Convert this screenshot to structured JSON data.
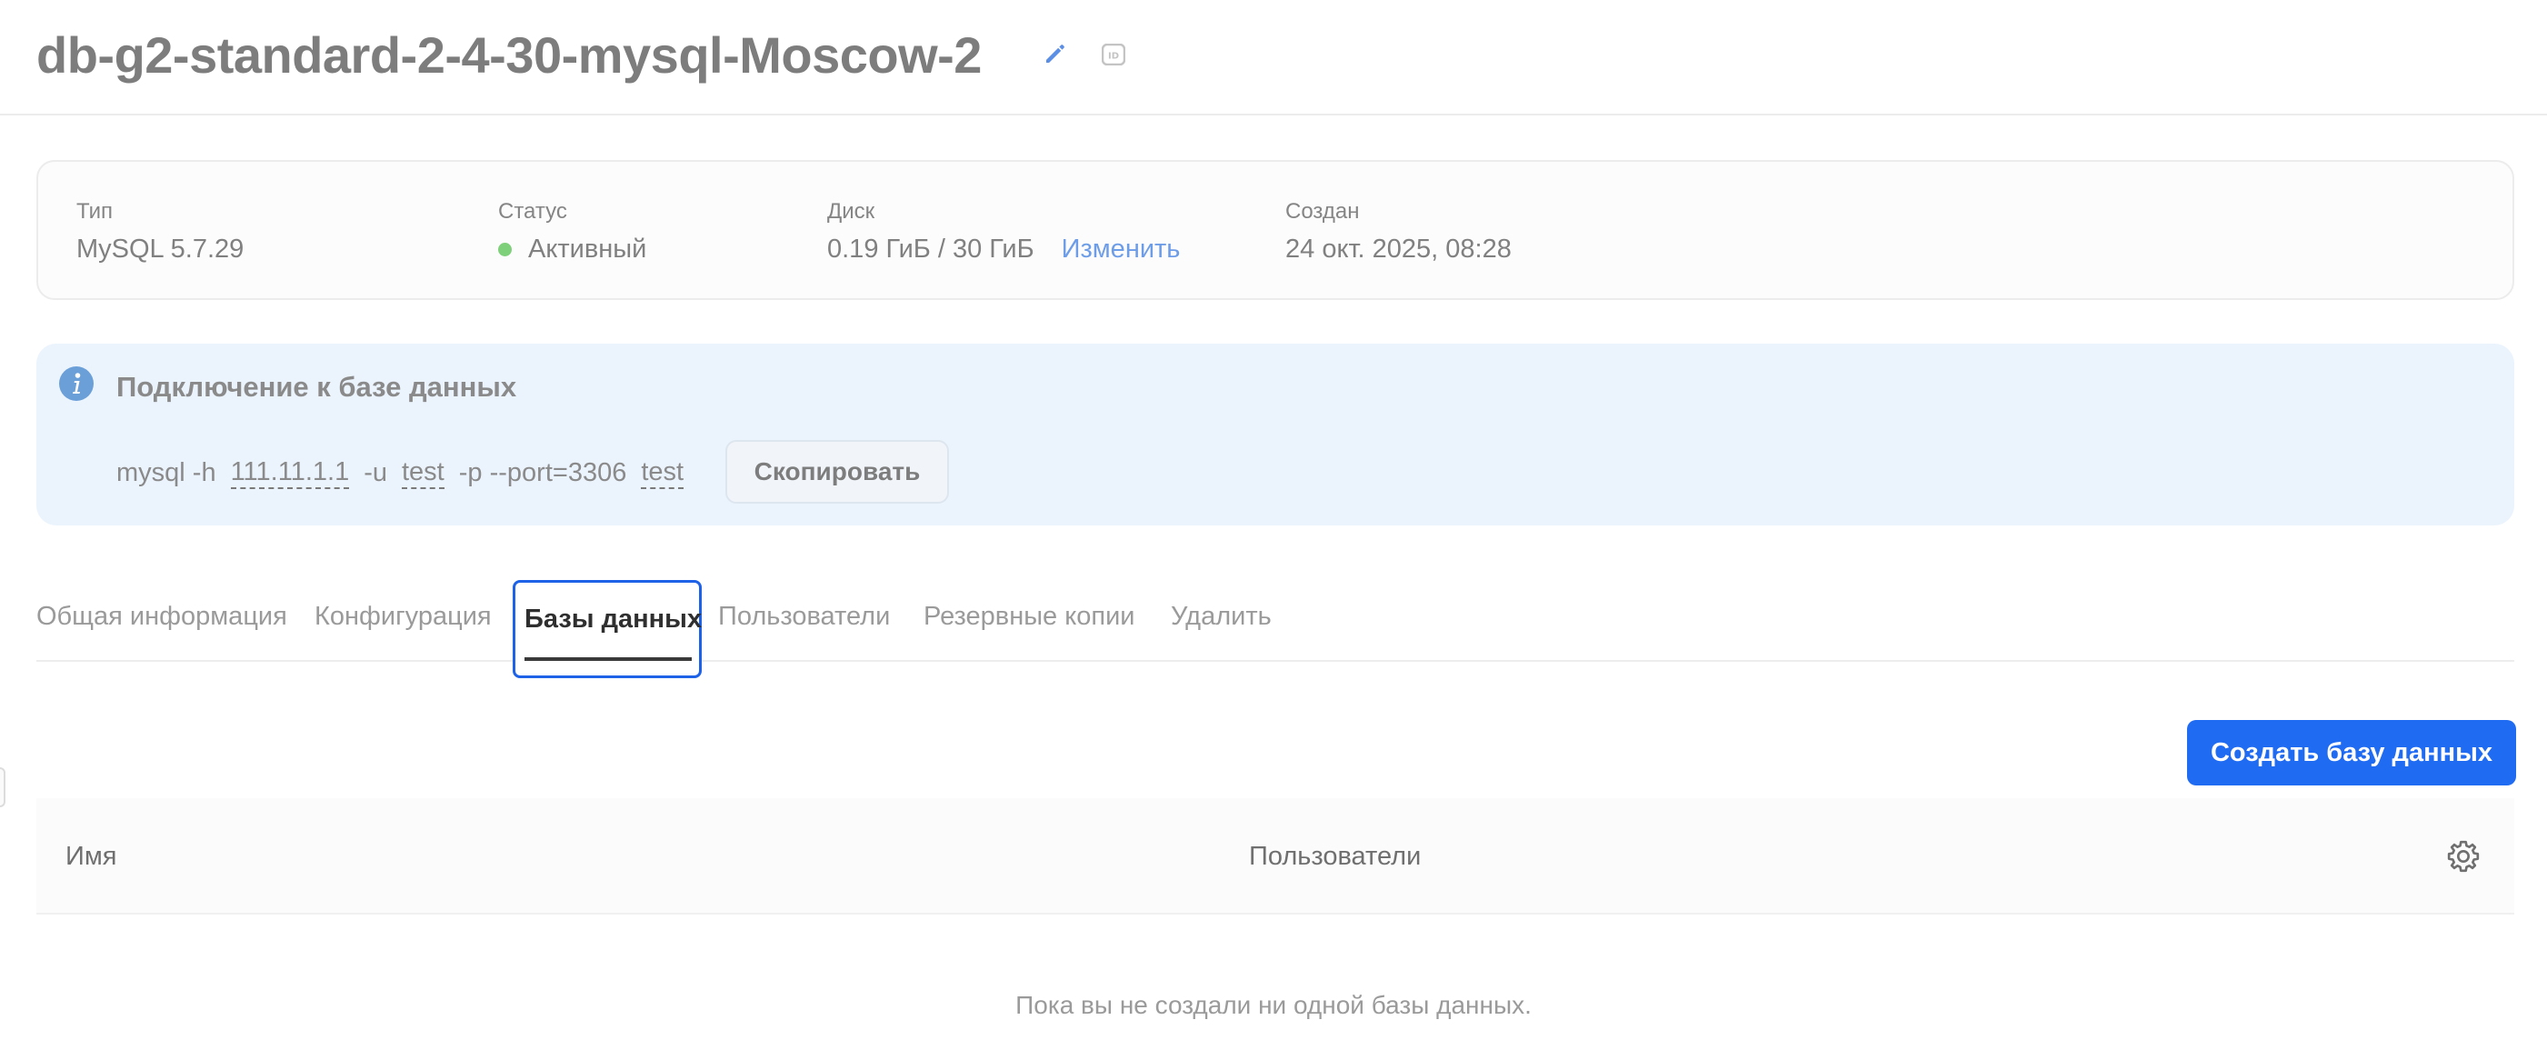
{
  "header": {
    "title": "db-g2-standard-2-4-30-mysql-Moscow-2",
    "edit_icon": "pencil-icon",
    "id_icon": "id-icon"
  },
  "info": {
    "type": {
      "label": "Тип",
      "value": "MySQL 5.7.29"
    },
    "status": {
      "label": "Статус",
      "value": "Активный",
      "dot_color": "#7fd07a"
    },
    "disk": {
      "label": "Диск",
      "value": "0.19 ГиБ / 30 ГиБ",
      "action": "Изменить"
    },
    "created": {
      "label": "Создан",
      "value": "24 окт. 2025, 08:28"
    }
  },
  "connection": {
    "icon": "info-icon",
    "title": "Подключение к базе данных",
    "cmd_prefix": "mysql -h",
    "host": "111.11.1.1",
    "user_flag": "-u",
    "user": "test",
    "port_part": "-p --port=3306",
    "database": "test",
    "copy_label": "Скопировать"
  },
  "tabs": [
    {
      "label": "Общая информация"
    },
    {
      "label": "Конфигурация"
    },
    {
      "label": "Базы данных",
      "active": true
    },
    {
      "label": "Пользователи"
    },
    {
      "label": "Резервные копии"
    },
    {
      "label": "Удалить"
    }
  ],
  "actions": {
    "create_label": "Создать базу данных"
  },
  "table": {
    "columns": [
      "Имя",
      "Пользователи"
    ],
    "settings_icon": "gear-icon",
    "empty_text": "Пока вы не создали ни одной базы данных."
  },
  "colors": {
    "accent": "#1f6bf2",
    "active_tab_border": "#1e62e8",
    "status_active": "#7fd07a",
    "link": "#6e9de8",
    "panel_bg": "#ebf3fd"
  }
}
